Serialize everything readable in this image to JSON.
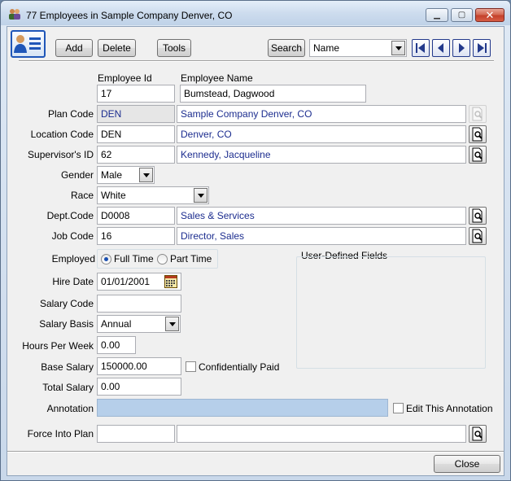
{
  "window": {
    "title": "77 Employees in Sample Company Denver, CO",
    "minimize": "▁",
    "maximize": "▢",
    "close": "✕"
  },
  "toolbar": {
    "add_label": "Add",
    "delete_label": "Delete",
    "tools_label": "Tools",
    "search_label": "Search",
    "search_field_selected": "Name"
  },
  "form": {
    "employee_id_header": "Employee Id",
    "employee_name_header": "Employee Name",
    "employee_id": "17",
    "employee_name": "Bumstead, Dagwood",
    "plan_code_label": "Plan Code",
    "plan_code": "DEN",
    "plan_name": "Sample Company Denver, CO",
    "location_code_label": "Location Code",
    "location_code": "DEN",
    "location_name": "Denver, CO",
    "supervisor_id_label": "Supervisor's ID",
    "supervisor_id": "62",
    "supervisor_name": "Kennedy, Jacqueline",
    "gender_label": "Gender",
    "gender": "Male",
    "race_label": "Race",
    "race": "White",
    "dept_code_label": "Dept.Code",
    "dept_code": "D0008",
    "dept_name": "Sales & Services",
    "job_code_label": "Job Code",
    "job_code": "16",
    "job_name": "Director, Sales",
    "employed_label": "Employed",
    "full_time_label": "Full Time",
    "part_time_label": "Part Time",
    "hire_date_label": "Hire Date",
    "hire_date": "01/01/2001",
    "salary_code_label": "Salary Code",
    "salary_code": "",
    "salary_basis_label": "Salary Basis",
    "salary_basis": "Annual",
    "hours_per_week_label": "Hours Per Week",
    "hours_per_week": "0.00",
    "base_salary_label": "Base Salary",
    "base_salary": "150000.00",
    "confidentially_paid_label": "Confidentially Paid",
    "total_salary_label": "Total Salary",
    "total_salary": "0.00",
    "annotation_label": "Annotation",
    "annotation": "",
    "edit_annotation_label": "Edit This Annotation",
    "force_into_plan_label": "Force Into Plan",
    "force_plan_code": "",
    "force_plan_name": ""
  },
  "user_defined": {
    "title": "User-Defined Fields"
  },
  "footer": {
    "close_label": "Close"
  },
  "colors": {
    "accent": "#1c2d8f",
    "annotation_bg": "#b6cfea",
    "nav_blue": "#23398b"
  }
}
